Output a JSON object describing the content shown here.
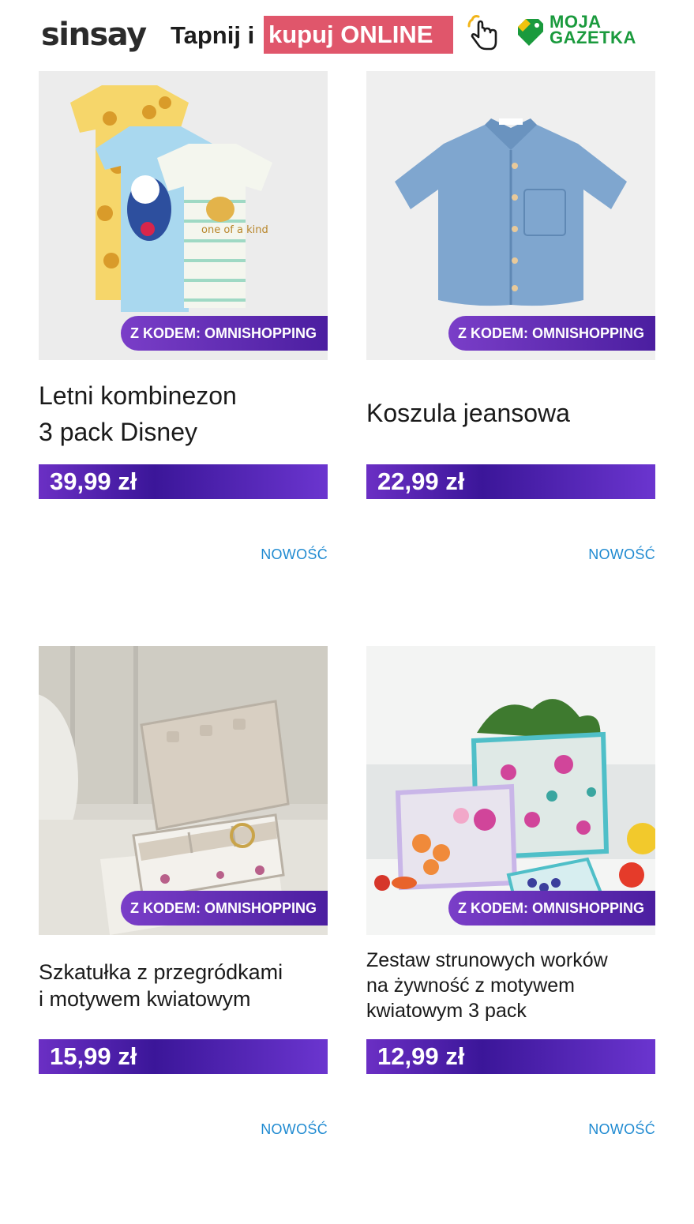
{
  "header": {
    "brand": "sinsay",
    "tap_text": "Tapnij i",
    "tap_highlight": "kupuj ONLINE",
    "partner_line1": "MOJA",
    "partner_line2": "GAZETKA",
    "colors": {
      "highlight": "#e0566b",
      "partner": "#1a9a3d"
    }
  },
  "products": [
    {
      "badge": "Z KODEM: OMNISHOPPING",
      "title_line1": "Letni kombinezon",
      "title_line2": "3 pack Disney",
      "price": "39,99 zł",
      "tag": "NOWOŚĆ",
      "image_icon": "kids-tshirts-image"
    },
    {
      "badge": "Z KODEM: OMNISHOPPING",
      "title_line1": "Koszula jeansowa",
      "price": "22,99 zł",
      "tag": "NOWOŚĆ",
      "image_icon": "denim-shirt-image"
    },
    {
      "badge": "Z KODEM: OMNISHOPPING",
      "title_line1": "Szkatułka z przegródkami",
      "title_line2": "i motywem kwiatowym",
      "price": "15,99 zł",
      "tag": "NOWOŚĆ",
      "image_icon": "jewelry-box-image"
    },
    {
      "badge": "Z KODEM: OMNISHOPPING",
      "title_line1": "Zestaw strunowych worków",
      "title_line2": "na żywność z motywem",
      "title_line3": "kwiatowym 3 pack",
      "price": "12,99 zł",
      "tag": "NOWOŚĆ",
      "image_icon": "food-bags-image"
    }
  ],
  "colors": {
    "price_bar": "#4b1ea0",
    "badge": "#6b2fc4",
    "new_tag": "#1f8ad1"
  }
}
